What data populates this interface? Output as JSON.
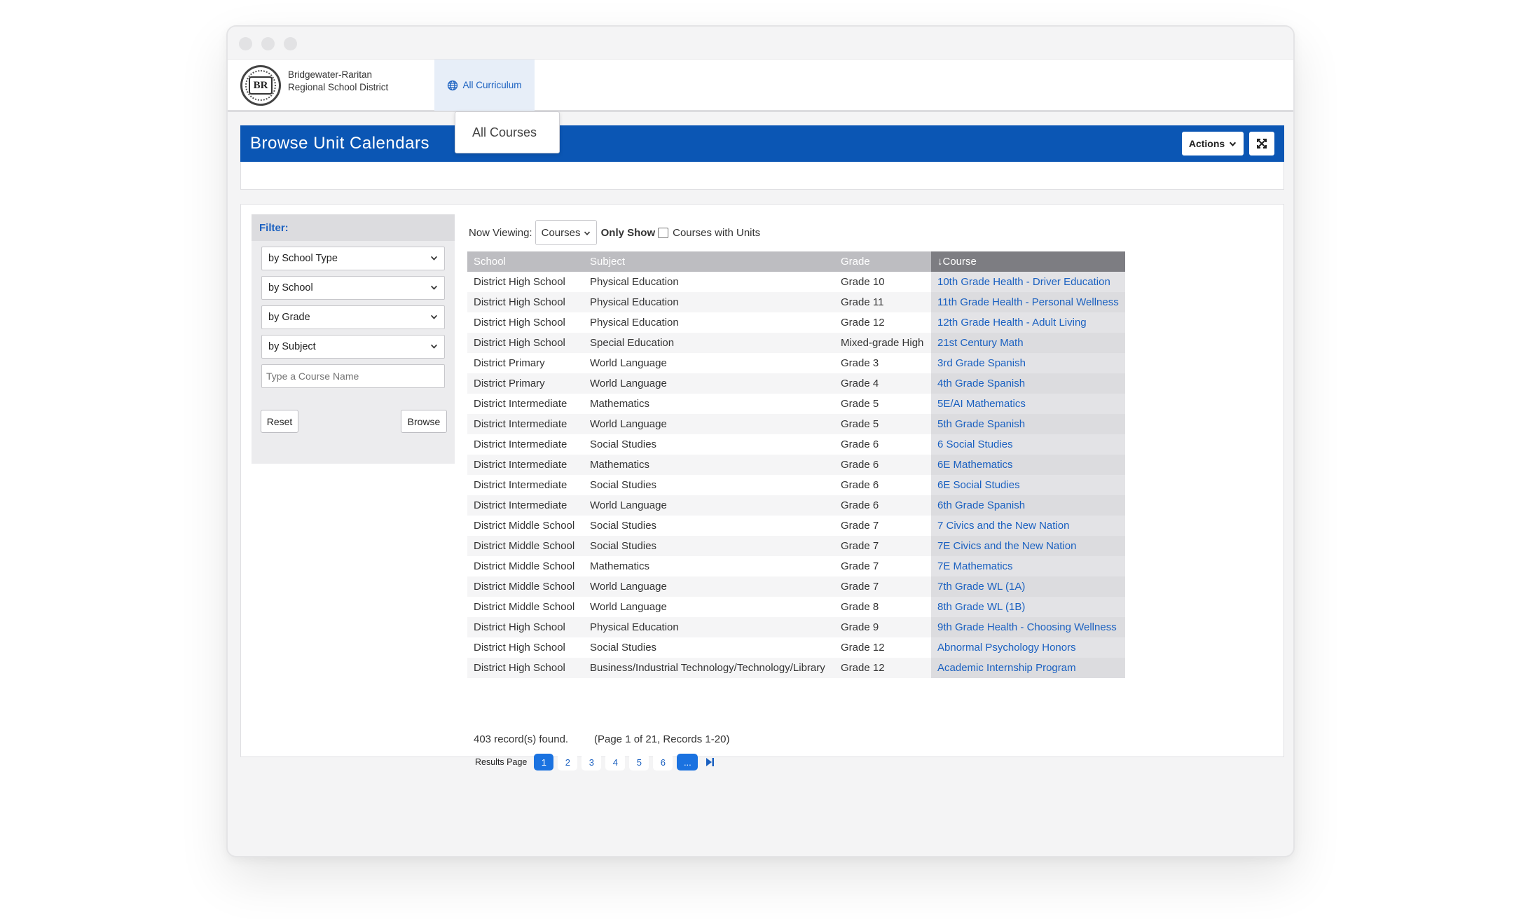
{
  "district": {
    "name": "Bridgewater-Raritan Regional School District",
    "logo_text": "BR"
  },
  "nav": {
    "all_curriculum": "All Curriculum",
    "dropdown_item": "All Courses"
  },
  "header": {
    "title": "Browse Unit Calendars",
    "actions_label": "Actions"
  },
  "filter": {
    "title": "Filter:",
    "selects": [
      "by School Type",
      "by School",
      "by Grade",
      "by Subject"
    ],
    "course_placeholder": "Type a Course Name",
    "reset_label": "Reset",
    "browse_label": "Browse"
  },
  "viewing": {
    "now_viewing": "Now Viewing:",
    "selected": "Courses",
    "only_show": "Only Show",
    "checkbox_label": "Courses with Units"
  },
  "table": {
    "columns": [
      "School",
      "Subject",
      "Grade",
      "↓Course"
    ],
    "rows": [
      [
        "District High School",
        "Physical Education",
        "Grade 10",
        "10th Grade Health - Driver Education"
      ],
      [
        "District High School",
        "Physical Education",
        "Grade 11",
        "11th Grade Health - Personal Wellness"
      ],
      [
        "District High School",
        "Physical Education",
        "Grade 12",
        "12th Grade Health - Adult Living"
      ],
      [
        "District High School",
        "Special Education",
        "Mixed-grade High",
        "21st Century Math"
      ],
      [
        "District Primary",
        "World Language",
        "Grade 3",
        "3rd Grade Spanish"
      ],
      [
        "District Primary",
        "World Language",
        "Grade 4",
        "4th Grade Spanish"
      ],
      [
        "District Intermediate",
        "Mathematics",
        "Grade 5",
        "5E/AI Mathematics"
      ],
      [
        "District Intermediate",
        "World Language",
        "Grade 5",
        "5th Grade Spanish"
      ],
      [
        "District Intermediate",
        "Social Studies",
        "Grade 6",
        "6 Social Studies"
      ],
      [
        "District Intermediate",
        "Mathematics",
        "Grade 6",
        "6E Mathematics"
      ],
      [
        "District Intermediate",
        "Social Studies",
        "Grade 6",
        "6E Social Studies"
      ],
      [
        "District Intermediate",
        "World Language",
        "Grade 6",
        "6th Grade Spanish"
      ],
      [
        "District Middle School",
        "Social Studies",
        "Grade 7",
        "7 Civics and the New Nation"
      ],
      [
        "District Middle School",
        "Social Studies",
        "Grade 7",
        "7E Civics and the New Nation"
      ],
      [
        "District Middle School",
        "Mathematics",
        "Grade 7",
        "7E Mathematics"
      ],
      [
        "District Middle School",
        "World Language",
        "Grade 7",
        "7th Grade WL (1A)"
      ],
      [
        "District Middle School",
        "World Language",
        "Grade 8",
        "8th Grade WL (1B)"
      ],
      [
        "District High School",
        "Physical Education",
        "Grade 9",
        "9th Grade Health - Choosing Wellness"
      ],
      [
        "District High School",
        "Social Studies",
        "Grade 12",
        "Abnormal Psychology Honors"
      ],
      [
        "District High School",
        "Business/Industrial Technology/Technology/Library",
        "Grade 12",
        "Academic Internship Program"
      ]
    ]
  },
  "records": {
    "found": "403 record(s) found.",
    "page_info": "(Page 1 of 21, Records 1-20)"
  },
  "pager": {
    "label": "Results Page",
    "pages": [
      "1",
      "2",
      "3",
      "4",
      "5",
      "6"
    ],
    "current": "1",
    "more": "..."
  },
  "colors": {
    "brand_blue": "#0b56b4",
    "link_blue": "#1a60c0",
    "active_page": "#1a72e0"
  },
  "icons": [
    "globe-icon",
    "chevron-down-icon",
    "expand-icon",
    "last-page-icon"
  ]
}
